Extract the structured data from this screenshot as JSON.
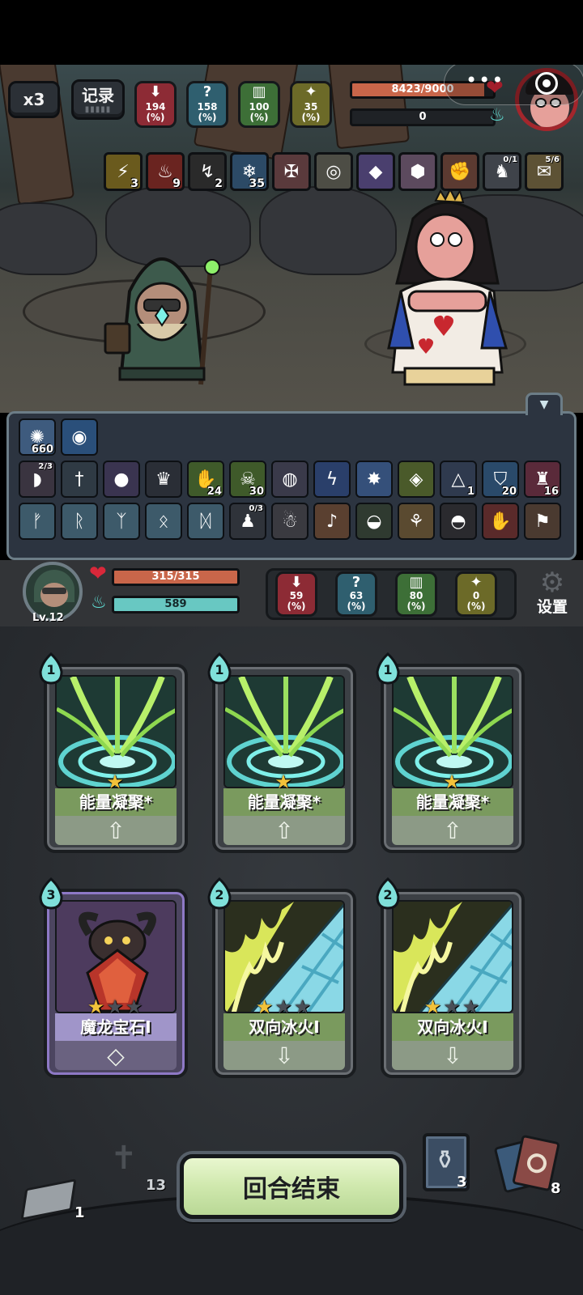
{
  "header": {
    "speed_label": "x3",
    "record_label": "记录",
    "enemy_stats": [
      {
        "id": "attack",
        "value": "194",
        "unit": "(%)",
        "color": "#8d2b35",
        "icon": "attack-down-icon"
      },
      {
        "id": "intel",
        "value": "158",
        "unit": "(%)",
        "color": "#2f5f6f",
        "icon": "question-icon"
      },
      {
        "id": "defense",
        "value": "100",
        "unit": "(%)",
        "color": "#3d6f37",
        "icon": "defense-icon"
      },
      {
        "id": "luck",
        "value": "35",
        "unit": "(%)",
        "color": "#6c6a28",
        "icon": "luck-icon"
      }
    ],
    "enemy_hp": {
      "text": "8423/9000",
      "current": 8423,
      "max": 9000
    },
    "enemy_energy": {
      "text": "0",
      "value": 0
    }
  },
  "enemy_status": [
    {
      "icon": "lightning-icon",
      "count": "3",
      "color": "#6a5a1d"
    },
    {
      "icon": "burn-icon",
      "count": "9",
      "color": "#6a2420"
    },
    {
      "icon": "arrow-down-icon",
      "count": "2",
      "color": "#2a2a2a"
    },
    {
      "icon": "snowflake-icon",
      "count": "35",
      "color": "#2c4a66"
    },
    {
      "icon": "claw-icon",
      "count": "",
      "color": "#5a3a3c"
    },
    {
      "icon": "shield-rune-icon",
      "count": "",
      "color": "#4d4d45"
    },
    {
      "icon": "crystal-icon",
      "count": "",
      "color": "#4a3f6e"
    },
    {
      "icon": "gem-icon",
      "count": "",
      "color": "#5c4a5e"
    },
    {
      "icon": "gauntlet-icon",
      "count": "",
      "color": "#5b3a31"
    },
    {
      "icon": "knight-icon",
      "count": "",
      "frac": "0/1",
      "color": "#3f434a"
    },
    {
      "icon": "scroll-icon",
      "count": "",
      "frac": "5/6",
      "color": "#5d5235"
    }
  ],
  "player_buffs": [
    {
      "icon": "storm-icon",
      "count": "660",
      "color": "#3e5b7e"
    },
    {
      "icon": "orb-icon",
      "count": "",
      "color": "#2a4f7a"
    }
  ],
  "relics_row1": [
    {
      "icon": "sausage-icon",
      "count": "",
      "frac": "2/3",
      "color": "#3a3440"
    },
    {
      "icon": "dagger-icon",
      "count": "",
      "color": "#2f3a44"
    },
    {
      "icon": "crystal-ball-icon",
      "count": "",
      "color": "#3a3450"
    },
    {
      "icon": "crown-dark-icon",
      "count": "",
      "color": "#2a2e36"
    },
    {
      "icon": "poison-hand-icon",
      "count": "24",
      "color": "#3f5a2a"
    },
    {
      "icon": "skull-icon",
      "count": "30",
      "color": "#3f5a2a"
    },
    {
      "icon": "vortex-icon",
      "count": "",
      "color": "#3a3a4a"
    },
    {
      "icon": "lightning-orb-icon",
      "count": "",
      "color": "#2a3f6a"
    },
    {
      "icon": "gem-burst-icon",
      "count": "",
      "color": "#35507a"
    },
    {
      "icon": "green-crystal-icon",
      "count": "",
      "color": "#4a5a2a"
    },
    {
      "icon": "triangle-icon",
      "count": "1",
      "color": "#2f3a4e"
    },
    {
      "icon": "blue-shield-icon",
      "count": "20",
      "color": "#2a4a6a"
    },
    {
      "icon": "red-figure-icon",
      "count": "16",
      "color": "#5a2a3a"
    }
  ],
  "relics_row2": [
    {
      "icon": "rune-a-icon",
      "count": "",
      "color": "#3d5a6a"
    },
    {
      "icon": "rune-b-icon",
      "count": "",
      "color": "#3d5a6a"
    },
    {
      "icon": "rune-c-icon",
      "count": "",
      "color": "#3d5a6a"
    },
    {
      "icon": "rune-d-icon",
      "count": "",
      "color": "#3d5a6a"
    },
    {
      "icon": "rune-e-icon",
      "count": "",
      "color": "#3d5a6a"
    },
    {
      "icon": "soldier-icon",
      "count": "",
      "frac": "0/3",
      "color": "#2f333a"
    },
    {
      "icon": "ghost-icon",
      "count": "",
      "color": "#3a3a40"
    },
    {
      "icon": "bell-icon",
      "count": "",
      "color": "#5a4030"
    },
    {
      "icon": "cauldron-icon",
      "count": "",
      "color": "#2f3a30"
    },
    {
      "icon": "broom-icon",
      "count": "",
      "color": "#5a4a30"
    },
    {
      "icon": "pan-icon",
      "count": "",
      "color": "#2a2a2e"
    },
    {
      "icon": "red-glove-icon",
      "count": "",
      "color": "#5a2a2a"
    },
    {
      "icon": "meat-icon",
      "count": "",
      "color": "#4a3a30"
    }
  ],
  "player": {
    "level": "Lv.12",
    "hp": {
      "text": "315/315",
      "current": 315,
      "max": 315
    },
    "energy": {
      "text": "589",
      "value": 589
    },
    "stats": [
      {
        "id": "attack",
        "value": "59",
        "unit": "(%)",
        "color": "#8d2b35"
      },
      {
        "id": "intel",
        "value": "63",
        "unit": "(%)",
        "color": "#2f5f6f"
      },
      {
        "id": "defense",
        "value": "80",
        "unit": "(%)",
        "color": "#3d6f37"
      },
      {
        "id": "luck",
        "value": "0",
        "unit": "(%)",
        "color": "#6c6a28"
      }
    ],
    "settings_label": "设置"
  },
  "cards": [
    {
      "name": "能量凝聚*",
      "cost": "1",
      "stars_filled": 1,
      "stars_total": 1,
      "kind": "energy",
      "foot": "up-arrow-icon"
    },
    {
      "name": "能量凝聚*",
      "cost": "1",
      "stars_filled": 1,
      "stars_total": 1,
      "kind": "energy",
      "foot": "up-arrow-icon"
    },
    {
      "name": "能量凝聚*",
      "cost": "1",
      "stars_filled": 1,
      "stars_total": 1,
      "kind": "energy",
      "foot": "up-arrow-icon"
    },
    {
      "name": "魔龙宝石I",
      "cost": "3",
      "stars_filled": 1,
      "stars_total": 3,
      "kind": "dragon",
      "foot": "diamond-icon"
    },
    {
      "name": "双向冰火I",
      "cost": "2",
      "stars_filled": 1,
      "stars_total": 3,
      "kind": "icefire",
      "foot": "down-arrow-icon"
    },
    {
      "name": "双向冰火I",
      "cost": "2",
      "stars_filled": 1,
      "stars_total": 3,
      "kind": "icefire",
      "foot": "down-arrow-icon"
    }
  ],
  "bottom": {
    "draw_pile": "1",
    "discard_pile": "13",
    "end_turn_label": "回合结束",
    "potion_count": "3",
    "deck_count": "8"
  }
}
